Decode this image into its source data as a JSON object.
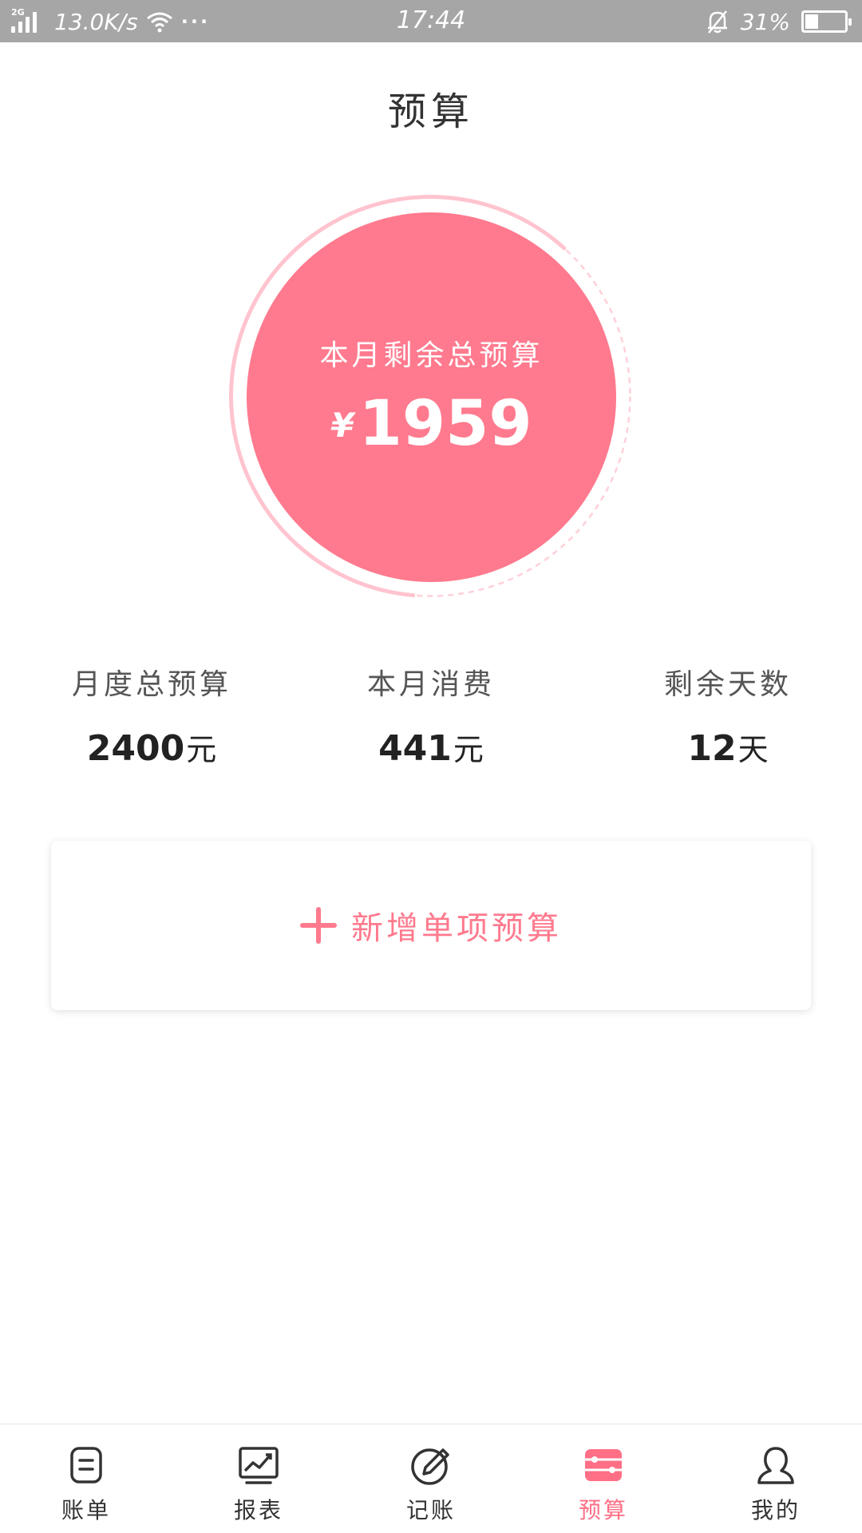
{
  "status_bar": {
    "network_tag": "2G",
    "speed": "13.0K/s",
    "more": "···",
    "time": "17:44",
    "battery": "31%",
    "battery_level": 0.31
  },
  "page": {
    "title": "预算"
  },
  "summary": {
    "label": "本月剩余总预算",
    "currency": "¥",
    "amount": "1959",
    "ring_color": "#ffc4cf",
    "fill_color": "#ff7a8e"
  },
  "stats": [
    {
      "label": "月度总预算",
      "value": "2400",
      "unit": "元"
    },
    {
      "label": "本月消费",
      "value": "441",
      "unit": "元"
    },
    {
      "label": "剩余天数",
      "value": "12",
      "unit": "天"
    }
  ],
  "add_budget": {
    "label": "新增单项预算"
  },
  "tabs": [
    {
      "label": "账单",
      "icon": "bill-icon",
      "active": false
    },
    {
      "label": "报表",
      "icon": "chart-icon",
      "active": false
    },
    {
      "label": "记账",
      "icon": "pen-icon",
      "active": false
    },
    {
      "label": "预算",
      "icon": "budget-icon",
      "active": true
    },
    {
      "label": "我的",
      "icon": "user-icon",
      "active": false
    }
  ],
  "colors": {
    "accent": "#ff7a8e",
    "status_bar": "#a6a6a6"
  }
}
